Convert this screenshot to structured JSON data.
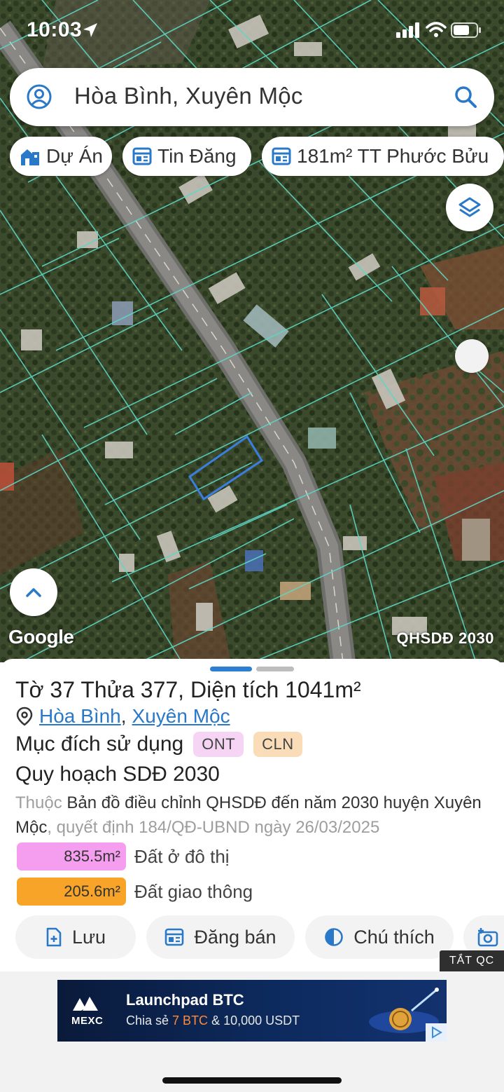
{
  "status_bar": {
    "time": "10:03"
  },
  "search": {
    "query": "Hòa Bình, Xuyên Mộc"
  },
  "chips": [
    {
      "label": "Dự Án",
      "icon": "building-icon"
    },
    {
      "label": "Tin Đăng",
      "icon": "listing-icon"
    },
    {
      "label": "181m² TT Phước Bửu",
      "icon": "listing-icon"
    }
  ],
  "map": {
    "attribution": "Google",
    "layer_label": "QHSDĐ 2030",
    "parcel_outline_color": "#3a7fe0",
    "boundary_color": "#5fd6c6"
  },
  "parcel": {
    "sheet_label": "Tờ",
    "sheet_no": "37",
    "lot_label": "Thửa",
    "lot_no": "377",
    "area_label": "Diện tích",
    "area_value": "1041",
    "area_unit": "m²",
    "ward": "Hòa Bình",
    "district": "Xuyên Mộc",
    "purpose_label": "Mục đích sử dụng",
    "purpose_tags": [
      "ONT",
      "CLN"
    ]
  },
  "plan": {
    "title": "Quy hoạch SDĐ 2030",
    "belongs_label": "Thuộc",
    "map_name": "Bản đồ điều chỉnh QHSDĐ đến năm 2030 huyện Xuyên Mộc",
    "decision_text": ", quyết định 184/QĐ-UBND ngày 26/03/2025",
    "areas": [
      {
        "value": "835.5m²",
        "label": "Đất ở đô thị",
        "color": "#f59ef0"
      },
      {
        "value": "205.6m²",
        "label": "Đất giao thông",
        "color": "#f7a429"
      }
    ]
  },
  "actions": [
    {
      "label": "Lưu",
      "icon": "add-file-icon"
    },
    {
      "label": "Đăng bán",
      "icon": "listing-icon"
    },
    {
      "label": "Chú thích",
      "icon": "legend-icon"
    }
  ],
  "ad_close_label": "TẮT QC",
  "ad": {
    "brand": "MEXC",
    "title": "Launchpad BTC",
    "sub_prefix": "Chia sẻ ",
    "sub_highlight": "7 BTC",
    "sub_suffix": " & 10,000 USDT"
  }
}
